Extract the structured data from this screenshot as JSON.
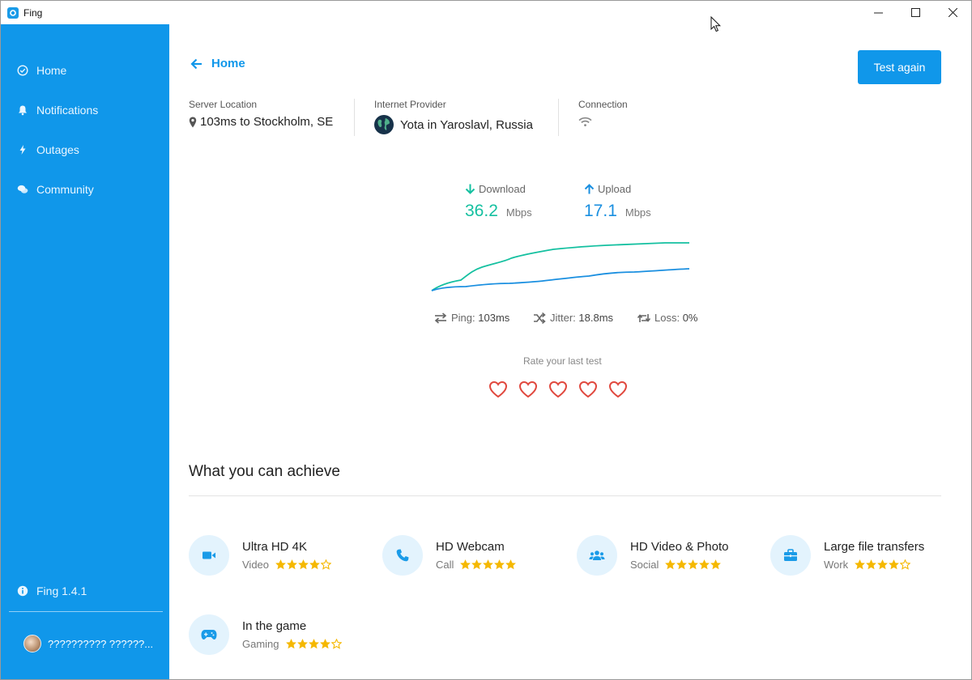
{
  "window": {
    "title": "Fing"
  },
  "sidebar": {
    "items": [
      {
        "label": "Home",
        "icon": "check-circle-icon"
      },
      {
        "label": "Notifications",
        "icon": "bell-icon"
      },
      {
        "label": "Outages",
        "icon": "bolt-icon"
      },
      {
        "label": "Community",
        "icon": "comments-icon"
      }
    ],
    "version": "Fing 1.4.1",
    "user": "?????????? ??????..."
  },
  "header": {
    "back_label": "Home",
    "test_again": "Test again"
  },
  "info": {
    "server_label": "Server Location",
    "server_value": "103ms to Stockholm, SE",
    "provider_label": "Internet Provider",
    "provider_value": "Yota in Yaroslavl, Russia",
    "connection_label": "Connection"
  },
  "speed": {
    "download_label": "Download",
    "download_value": "36.2",
    "upload_label": "Upload",
    "upload_value": "17.1",
    "unit": "Mbps"
  },
  "stats": {
    "ping_label": "Ping:",
    "ping_value": "103ms",
    "jitter_label": "Jitter:",
    "jitter_value": "18.8ms",
    "loss_label": "Loss:",
    "loss_value": "0%"
  },
  "rating": {
    "label": "Rate your last test",
    "count": 5
  },
  "achieve": {
    "title": "What you can achieve",
    "items": [
      {
        "title": "Ultra HD 4K",
        "category": "Video",
        "stars": 4,
        "icon": "video-camera-icon"
      },
      {
        "title": "HD Webcam",
        "category": "Call",
        "stars": 5,
        "icon": "phone-icon"
      },
      {
        "title": "HD Video & Photo",
        "category": "Social",
        "stars": 5,
        "icon": "users-icon"
      },
      {
        "title": "Large file transfers",
        "category": "Work",
        "stars": 4,
        "icon": "briefcase-icon"
      },
      {
        "title": "In the game",
        "category": "Gaming",
        "stars": 4,
        "icon": "gamepad-icon"
      }
    ]
  },
  "colors": {
    "accent": "#1097ea",
    "download": "#14c0a0",
    "upload": "#1a8fe0",
    "heart": "#e0473d",
    "star": "#f5b800"
  }
}
